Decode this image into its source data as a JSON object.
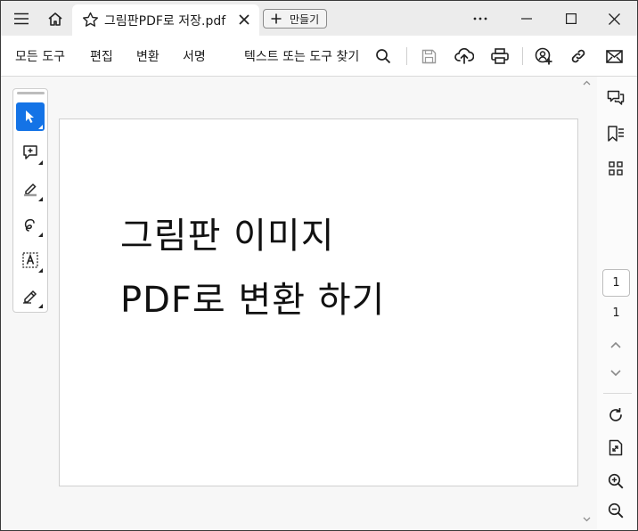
{
  "tab": {
    "title": "그림판PDF로 저장.pdf"
  },
  "new_tab": {
    "label": "만들기"
  },
  "menu": {
    "all_tools": "모든 도구",
    "edit": "편집",
    "convert": "변환",
    "sign": "서명"
  },
  "search": {
    "label": "텍스트 또는 도구 찾기"
  },
  "document": {
    "line1": "그림판 이미지",
    "line2": "PDF로 변환 하기"
  },
  "pagination": {
    "current": "1",
    "total": "1"
  },
  "colors": {
    "accent": "#1473e6",
    "chrome": "#ececec",
    "canvas": "#f7f7f7"
  }
}
